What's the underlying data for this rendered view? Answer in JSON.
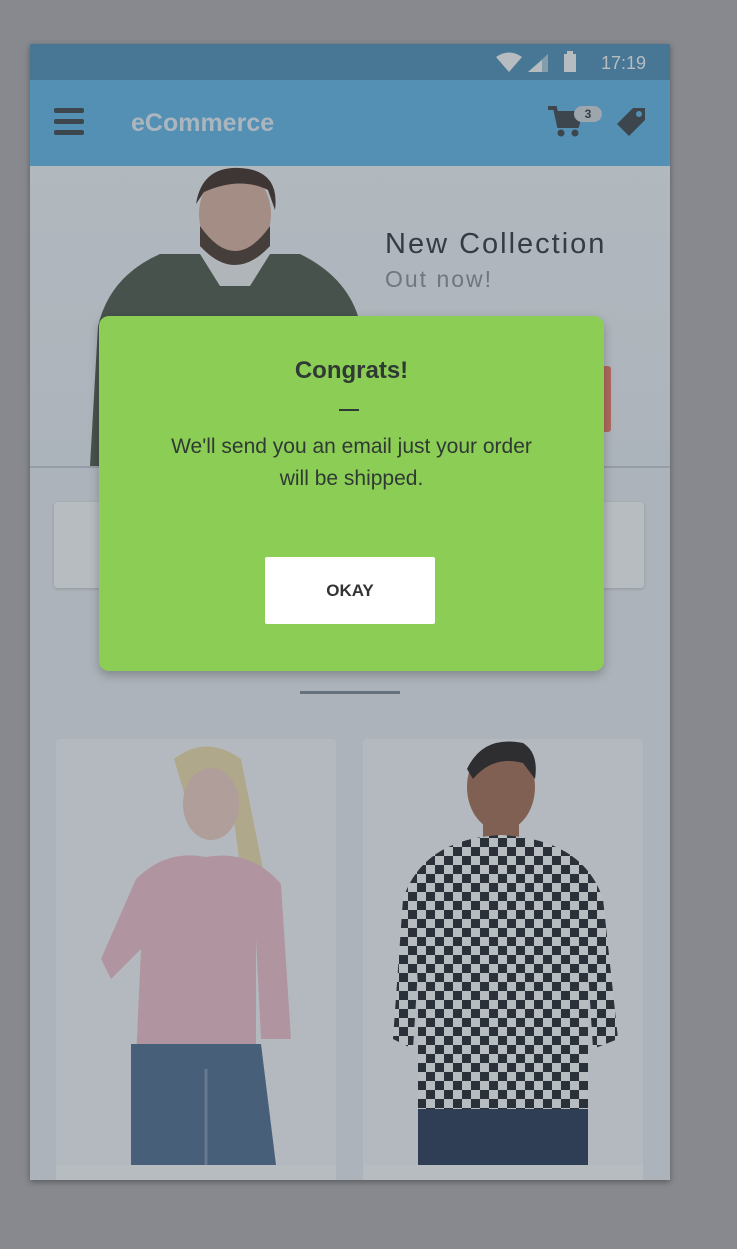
{
  "status_bar": {
    "time": "17:19"
  },
  "app_bar": {
    "title": "eCommerce",
    "cart_count": "3",
    "icons": [
      "menu-icon",
      "cart-icon",
      "tag-icon"
    ]
  },
  "hero": {
    "title": "New Collection",
    "subtitle": "Out now!"
  },
  "dialog": {
    "title": "Congrats!",
    "message": "We'll send you an email just your order will be shipped.",
    "button_label": "OKAY",
    "background_color": "#8ccd55"
  },
  "colors": {
    "app_bar": "#5fb6ea",
    "accent": "#f0785f"
  }
}
